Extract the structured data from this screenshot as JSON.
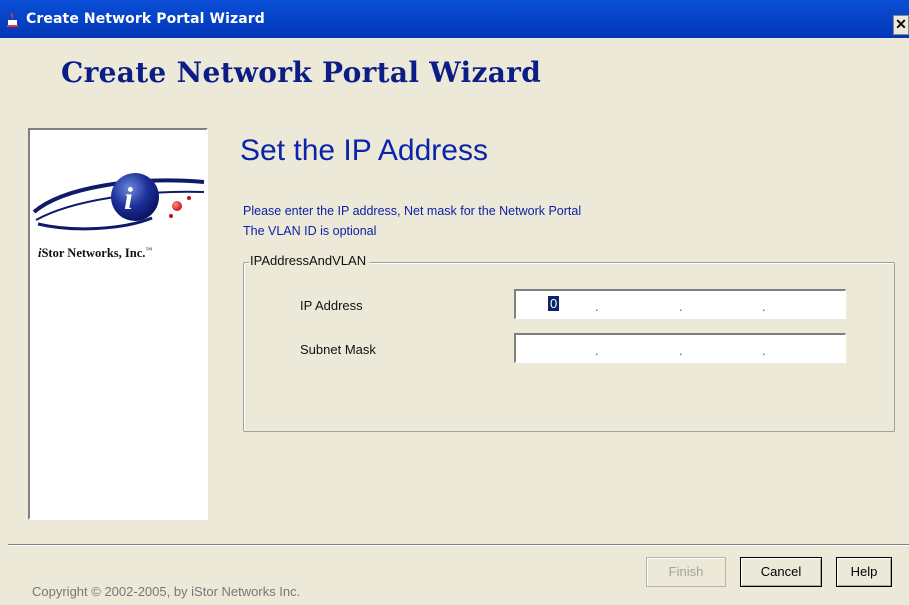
{
  "window": {
    "title": "Create Network Portal Wizard",
    "close_glyph": "✕"
  },
  "header": {
    "heading": "Create Network Portal Wizard"
  },
  "sidebar": {
    "company_prefix": "i",
    "company_name": "Stor Networks, Inc.",
    "trademark": "™"
  },
  "page": {
    "step_title": "Set the IP Address",
    "instruction_line1": "Please enter the IP address, Net mask for the Network Portal",
    "instruction_line2": "The VLAN ID is optional"
  },
  "group": {
    "legend": "IPAddressAndVLAN",
    "fields": [
      {
        "label": "IP Address",
        "octets": [
          "0",
          "",
          "",
          ""
        ]
      },
      {
        "label": "Subnet Mask",
        "octets": [
          "",
          "",
          "",
          ""
        ]
      }
    ],
    "separator": "."
  },
  "footer": {
    "copyright": "Copyright © 2002-2005, by iStor Networks Inc.",
    "buttons": {
      "finish": "Finish",
      "cancel": "Cancel",
      "help": "Help"
    }
  },
  "colors": {
    "titlebar": "#0a4fd6",
    "heading": "#0c1d86",
    "accent_text": "#0a1fa6",
    "background": "#ece9d8"
  },
  "icons": {
    "app": "java-cup-icon",
    "close": "close-icon",
    "logo": "istor-logo"
  }
}
